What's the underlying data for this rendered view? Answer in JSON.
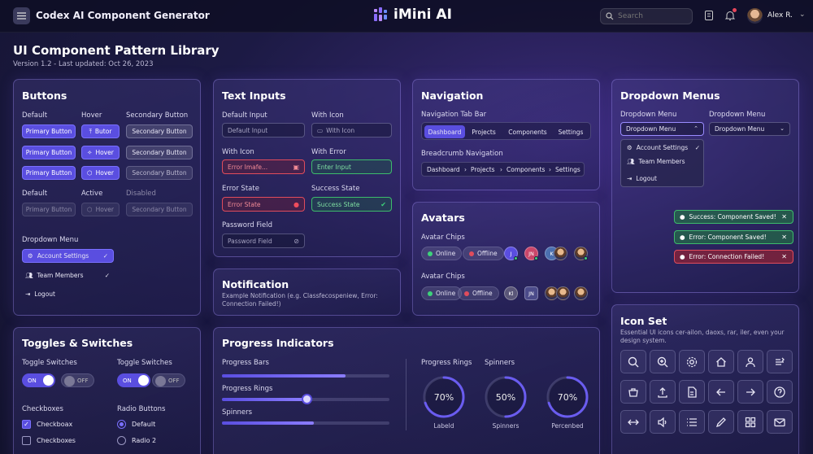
{
  "header": {
    "app_title": "Codex AI Component Generator",
    "brand": "iMini AI",
    "search_placeholder": "Search",
    "user_name": "Alex R."
  },
  "page": {
    "title": "UI Component Pattern Library",
    "subtitle": "Version 1.2 - Last updated: Oct 26, 2023"
  },
  "buttons": {
    "title": "Buttons",
    "col_default": "Default",
    "col_hover": "Hover",
    "col_secondary": "Secondary Button",
    "primary": "Primary Button",
    "butor": "Butor",
    "hover": "Hover",
    "secondary": "Secondary Button",
    "state_default": "Default",
    "state_active": "Active",
    "state_disabled": "Disabled",
    "dropdown_label": "Dropdown Menu",
    "menu_items": [
      "Account Settings",
      "Team Members",
      "Logout"
    ]
  },
  "text_inputs": {
    "title": "Text Inputs",
    "default_label": "Default Input",
    "default_placeholder": "Default Input",
    "with_icon_label": "With Icon",
    "with_icon_placeholder": "With Icon",
    "with_icon2_label": "With Icon",
    "error_image_placeholder": "Error Imafe...",
    "with_error_label": "With Error",
    "enter_input_placeholder": "Enter Input",
    "error_state_label": "Error State",
    "error_state_value": "Error State",
    "success_state_label": "Success State",
    "success_state_value": "Success State",
    "password_label": "Password Field",
    "password_placeholder": "Password Field"
  },
  "navigation": {
    "title": "Navigation",
    "tabbar_label": "Navigation Tab Bar",
    "tabs": [
      "Dashboard",
      "Projects",
      "Components",
      "Settings"
    ],
    "breadcrumb_label": "Breadcrumb Navigation",
    "crumbs": [
      "Dashboard",
      "Projects",
      "Components",
      "Settings"
    ]
  },
  "notification": {
    "title": "Notification",
    "text": "Example Notification (e.g. Classfecospeniew, Error: Connection Failed!)"
  },
  "avatars": {
    "title": "Avatars",
    "chips_label_1": "Avatar Chips",
    "chips_label_2": "Avatar Chips",
    "online": "Online",
    "offline": "Offline",
    "initials": [
      "J",
      "JN",
      "K",
      "Kl",
      "JN"
    ]
  },
  "dropdowns": {
    "title": "Dropdown Menus",
    "label_1": "Dropdown Menu",
    "label_2": "Dropdown Menu",
    "value_1": "Dropdown Menu",
    "value_2": "Dropdown Menu",
    "menu_items": [
      "Account Settings",
      "Team Members",
      "Logout"
    ],
    "toasts": [
      "Success: Component Saved!",
      "Error: Component Saved!",
      "Error: Connection Failed!"
    ]
  },
  "toggles": {
    "title": "Toggles & Switches",
    "label_1": "Toggle Switches",
    "label_2": "Toggle Switches",
    "on": "ON",
    "off": "OFF",
    "checkbox_label": "Checkboxes",
    "radio_label": "Radio Buttons",
    "checkboxes": [
      "Checkboax",
      "Checkboxes"
    ],
    "radios": [
      "Default",
      "Radio 2"
    ],
    "checkbox_checked": [
      true,
      false
    ],
    "radio_selected": 0
  },
  "progress": {
    "title": "Progress Indicators",
    "bars_label": "Progress Bars",
    "rings_label": "Progress Rings",
    "spinners_label": "Spinners",
    "bar_values": [
      0.74,
      0.51,
      0.55
    ],
    "col_rings": "Progress Rings",
    "col_spinners": "Spinners",
    "rings": [
      {
        "value": "70%",
        "fraction": 0.7,
        "label": "Labeld"
      },
      {
        "value": "50%",
        "fraction": 0.5,
        "label": "Spinners"
      },
      {
        "value": "70%",
        "fraction": 0.7,
        "label": "Percenbed"
      }
    ]
  },
  "icon_set": {
    "title": "Icon Set",
    "desc": "Essential UI icons cer-ailon, daoxs, rar, iler, even your design system.",
    "icons": [
      "search-icon",
      "zoom-in-icon",
      "gear-icon",
      "home-icon",
      "user-icon",
      "sort-icon",
      "basket-icon",
      "upload-icon",
      "document-icon",
      "arrow-left-icon",
      "arrow-right-icon",
      "help-icon",
      "transfer-icon",
      "volume-icon",
      "list-icon",
      "pencil-icon",
      "grid-icon",
      "mail-icon"
    ]
  },
  "colors": {
    "accent": "#5a4ee0",
    "success": "#3dbb6c",
    "error": "#e04c5c"
  }
}
